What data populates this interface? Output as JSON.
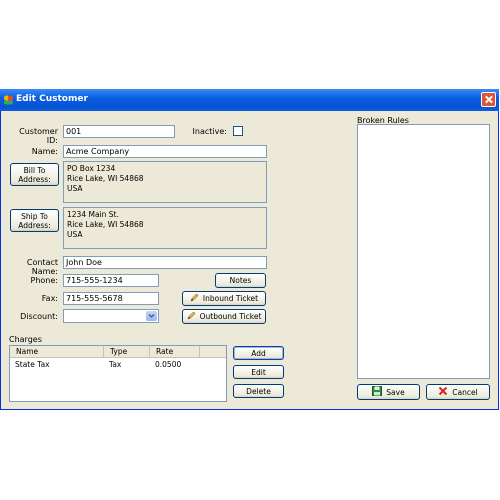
{
  "window": {
    "title": "Edit Customer"
  },
  "form": {
    "customer_id_label": "Customer ID:",
    "customer_id": "001",
    "inactive_label": "Inactive:",
    "name_label": "Name:",
    "name": "Acme Company",
    "bill_to_button": "Bill To Address:",
    "bill_to_address": "PO Box 1234\nRice Lake, WI 54868\nUSA",
    "ship_to_button": "Ship To Address:",
    "ship_to_address": "1234 Main St.\nRice Lake, WI 54868\nUSA",
    "contact_label": "Contact Name:",
    "contact": "John Doe",
    "phone_label": "Phone:",
    "phone": "715-555-1234",
    "fax_label": "Fax:",
    "fax": "715-555-5678",
    "discount_label": "Discount:",
    "discount": "",
    "notes_button": "Notes",
    "inbound_button": "Inbound Ticket",
    "outbound_button": "Outbound Ticket"
  },
  "charges": {
    "label": "Charges",
    "columns": [
      "Name",
      "Type",
      "Rate"
    ],
    "rows": [
      {
        "name": "State Tax",
        "type": "Tax",
        "rate": "0.0500"
      }
    ],
    "add_button": "Add",
    "edit_button": "Edit",
    "delete_button": "Delete"
  },
  "broken_rules": {
    "label": "Broken Rules"
  },
  "footer": {
    "save_button": "Save",
    "cancel_button": "Cancel"
  },
  "colors": {
    "title_bar": "#0a5fe0",
    "window_bg": "#ece9d8",
    "close": "#e0533a"
  }
}
